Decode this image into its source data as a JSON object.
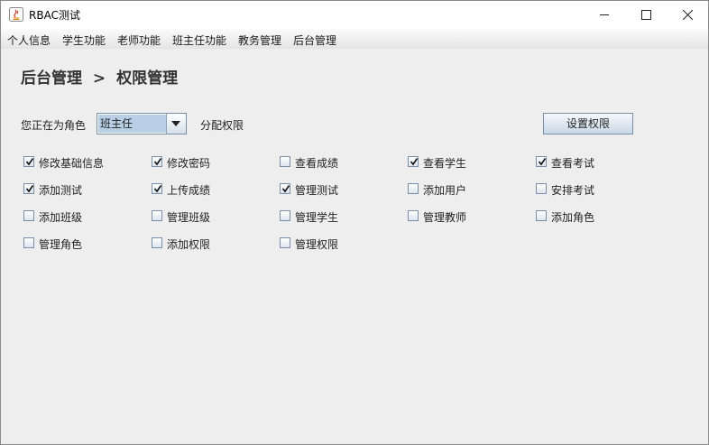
{
  "window": {
    "title": "RBAC测试"
  },
  "menu": [
    "个人信息",
    "学生功能",
    "老师功能",
    "班主任功能",
    "教务管理",
    "后台管理"
  ],
  "breadcrumb": {
    "parent": "后台管理",
    "separator": ">",
    "current": "权限管理"
  },
  "role_prompt": "您正在为角色",
  "role_selected": "班主任",
  "assign_label": "分配权限",
  "set_button": "设置权限",
  "permissions": [
    {
      "label": "修改基础信息",
      "checked": true
    },
    {
      "label": "修改密码",
      "checked": true
    },
    {
      "label": "查看成绩",
      "checked": false
    },
    {
      "label": "查看学生",
      "checked": true
    },
    {
      "label": "查看考试",
      "checked": true
    },
    {
      "label": "添加测试",
      "checked": true
    },
    {
      "label": "上传成绩",
      "checked": true
    },
    {
      "label": "管理测试",
      "checked": true
    },
    {
      "label": "添加用户",
      "checked": false
    },
    {
      "label": "安排考试",
      "checked": false
    },
    {
      "label": "添加班级",
      "checked": false
    },
    {
      "label": "管理班级",
      "checked": false
    },
    {
      "label": "管理学生",
      "checked": false
    },
    {
      "label": "管理教师",
      "checked": false
    },
    {
      "label": "添加角色",
      "checked": false
    },
    {
      "label": "管理角色",
      "checked": false
    },
    {
      "label": "添加权限",
      "checked": false
    },
    {
      "label": "管理权限",
      "checked": false
    }
  ]
}
